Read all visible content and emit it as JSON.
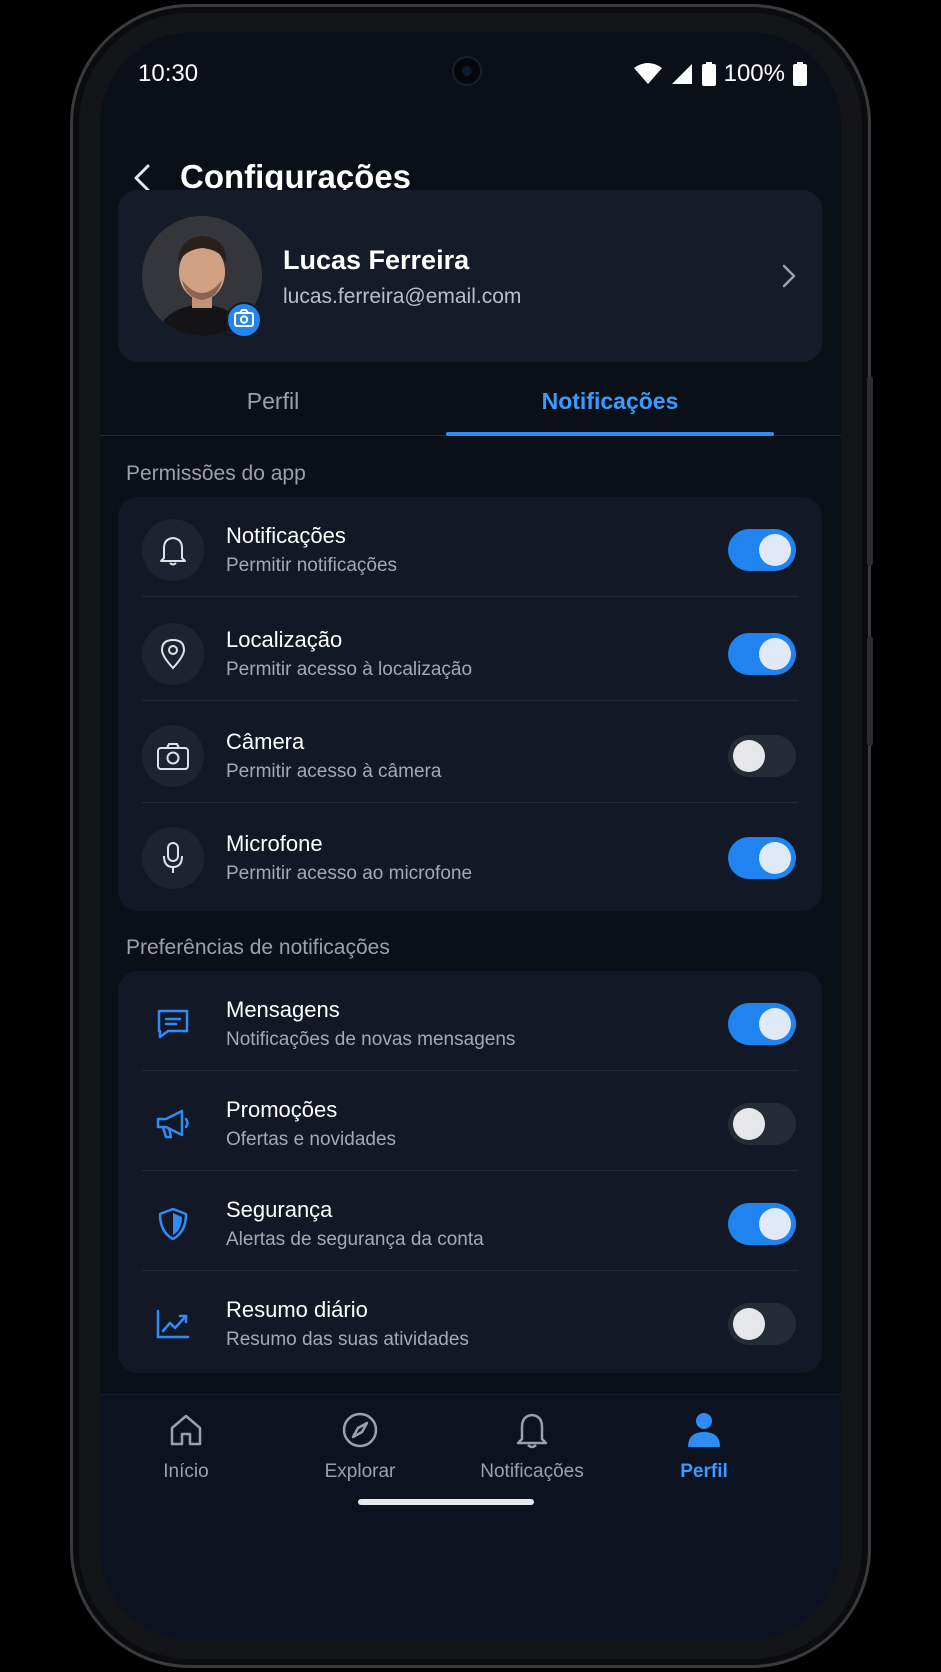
{
  "status_bar": {
    "time": "10:30",
    "battery": "100%"
  },
  "header": {
    "title": "Configurações"
  },
  "profile": {
    "name": "Lucas Ferreira",
    "email": "lucas.ferreira@email.com"
  },
  "tabs": [
    {
      "label": "Perfil",
      "active": false
    },
    {
      "label": "Notificações",
      "active": true
    }
  ],
  "permissions": {
    "section_label": "Permissões do app",
    "items": [
      {
        "title": "Notificações",
        "subtitle": "Permitir notificações",
        "icon": "bell-icon",
        "enabled": true
      },
      {
        "title": "Localização",
        "subtitle": "Permitir acesso à localização",
        "icon": "location-pin-icon",
        "enabled": true
      },
      {
        "title": "Câmera",
        "subtitle": "Permitir acesso à câmera",
        "icon": "camera-icon",
        "enabled": false
      },
      {
        "title": "Microfone",
        "subtitle": "Permitir acesso ao microfone",
        "icon": "microphone-icon",
        "enabled": true
      }
    ]
  },
  "preferences": {
    "section_label": "Preferências de notificações",
    "items": [
      {
        "title": "Mensagens",
        "subtitle": "Notificações de novas mensagens",
        "icon": "message-icon",
        "enabled": true
      },
      {
        "title": "Promoções",
        "subtitle": "Ofertas e novidades",
        "icon": "megaphone-icon",
        "enabled": false
      },
      {
        "title": "Segurança",
        "subtitle": "Alertas de segurança da conta",
        "icon": "shield-icon",
        "enabled": true
      },
      {
        "title": "Resumo diário",
        "subtitle": "Resumo das suas atividades",
        "icon": "chart-icon",
        "enabled": false
      }
    ]
  },
  "bottom_nav": [
    {
      "label": "Início",
      "icon": "home-icon",
      "active": false
    },
    {
      "label": "Explorar",
      "icon": "compass-icon",
      "active": false
    },
    {
      "label": "Notificações",
      "icon": "bell-icon",
      "active": false
    },
    {
      "label": "Perfil",
      "icon": "user-icon",
      "active": true
    }
  ],
  "colors": {
    "accent": "#1f84f0",
    "background": "#0b0f18",
    "card": "#151b28"
  }
}
